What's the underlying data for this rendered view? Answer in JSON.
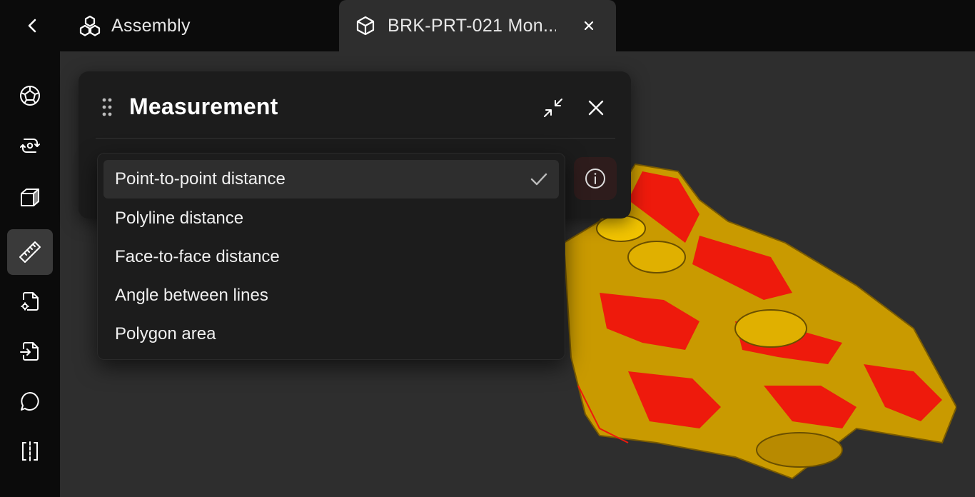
{
  "header": {
    "back_icon": "chevron-left-icon",
    "assembly_tab": {
      "icon": "assembly-icon",
      "label": "Assembly"
    },
    "part_tab": {
      "icon": "cube-icon",
      "label": "BRK-PRT-021 Mon..."
    }
  },
  "sidebar": {
    "items": [
      {
        "name": "model-tree",
        "icon": "polyhedron-icon"
      },
      {
        "name": "rotate-view",
        "icon": "rotate-view-icon"
      },
      {
        "name": "views",
        "icon": "cube-view-icon"
      },
      {
        "name": "measure",
        "icon": "ruler-icon",
        "active": true
      },
      {
        "name": "file-settings",
        "icon": "file-settings-icon"
      },
      {
        "name": "import",
        "icon": "file-import-icon"
      },
      {
        "name": "comments",
        "icon": "comment-icon"
      },
      {
        "name": "section",
        "icon": "section-icon"
      }
    ]
  },
  "measurement_panel": {
    "title": "Measurement",
    "collapse_icon": "collapse-icon",
    "close_icon": "close-icon",
    "info_icon": "info-icon",
    "options": [
      {
        "label": "Point-to-point distance",
        "selected": true
      },
      {
        "label": "Polyline distance"
      },
      {
        "label": "Face-to-face distance"
      },
      {
        "label": "Angle between lines"
      },
      {
        "label": "Polygon area"
      }
    ]
  },
  "colors": {
    "background": "#2e2e2e",
    "bar": "#0b0b0b",
    "panel": "#1c1c1c",
    "model_yellow": "#e0a800",
    "model_red": "#ee1a0c"
  }
}
